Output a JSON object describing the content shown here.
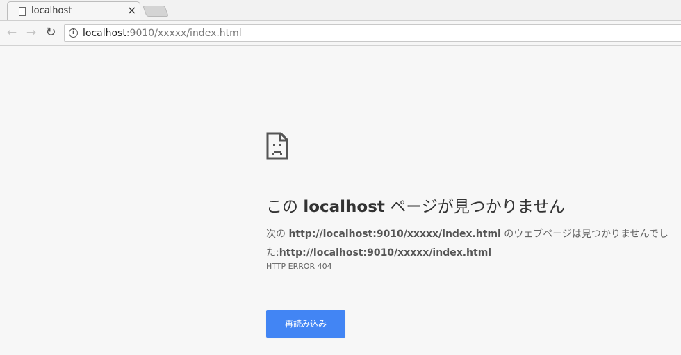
{
  "tab": {
    "title": "localhost",
    "close_glyph": "×"
  },
  "toolbar": {
    "back_glyph": "←",
    "forward_glyph": "→",
    "reload_glyph": "↻",
    "info_glyph": "i",
    "url_host": "localhost",
    "url_rest": ":9010/xxxxx/index.html"
  },
  "error": {
    "title_prefix": "この ",
    "title_host": "localhost",
    "title_suffix": " ページが見つかりません",
    "desc_prefix": "次の ",
    "desc_url1": "http://localhost:9010/xxxxx/index.html",
    "desc_mid": " のウェブページは見つかりませんでした:",
    "desc_url2": "http://localhost:9010/xxxxx/index.html",
    "code": "HTTP ERROR 404",
    "reload_label": "再読み込み"
  },
  "colors": {
    "accent": "#4285f4",
    "page_bg": "#f7f7f7"
  }
}
